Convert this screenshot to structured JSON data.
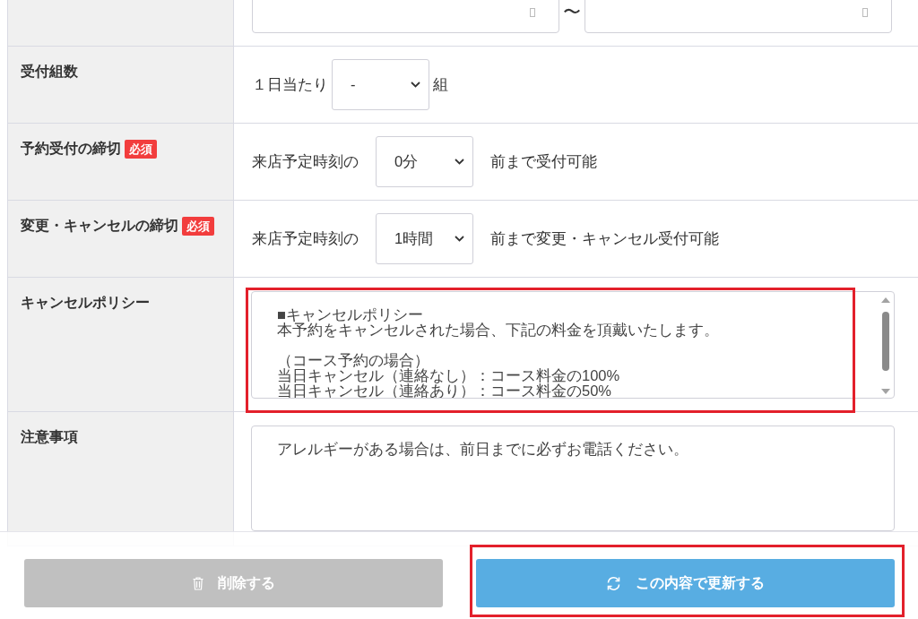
{
  "form_rows": [
    {
      "kind": "date_range",
      "separator": "〜",
      "highlighted": false
    },
    {
      "kind": "select",
      "label": "受付組数",
      "prefix": "１日当たり",
      "value": "-",
      "suffix": "組",
      "highlighted": false
    },
    {
      "kind": "select",
      "label": "予約受付の締切",
      "badge": "必須",
      "prefix": "来店予定時刻の",
      "value": "0分",
      "suffix": "前まで受付可能",
      "highlighted": false
    },
    {
      "kind": "select",
      "label": "変更・キャンセルの締切",
      "badge": "必須",
      "prefix": "来店予定時刻の",
      "value": "1時間",
      "suffix": "前まで変更・キャンセル受付可能",
      "highlighted": false
    },
    {
      "kind": "textarea",
      "label": "キャンセルポリシー",
      "paragraphs": [
        {
          "lines": [
            "■キャンセルポリシー",
            "本予約をキャンセルされた場合、下記の料金を頂戴いたします。"
          ]
        },
        {
          "lines": [
            "（コース予約の場合）",
            "当日キャンセル（連絡なし）：コース料金の100%",
            "当日キャンセル（連絡あり）：コース料金の50%"
          ]
        }
      ],
      "scrollbar": true,
      "highlighted": true
    },
    {
      "kind": "textarea",
      "label": "注意事項",
      "paragraphs": [
        {
          "lines": [
            "アレルギーがある場合は、前日までに必ずお電話ください。"
          ]
        }
      ],
      "scrollbar": false,
      "highlighted": false
    }
  ],
  "actions": [
    {
      "kind": "delete",
      "label": "削除する",
      "highlighted": false
    },
    {
      "kind": "update",
      "label": "この内容で更新する",
      "highlighted": true
    }
  ]
}
